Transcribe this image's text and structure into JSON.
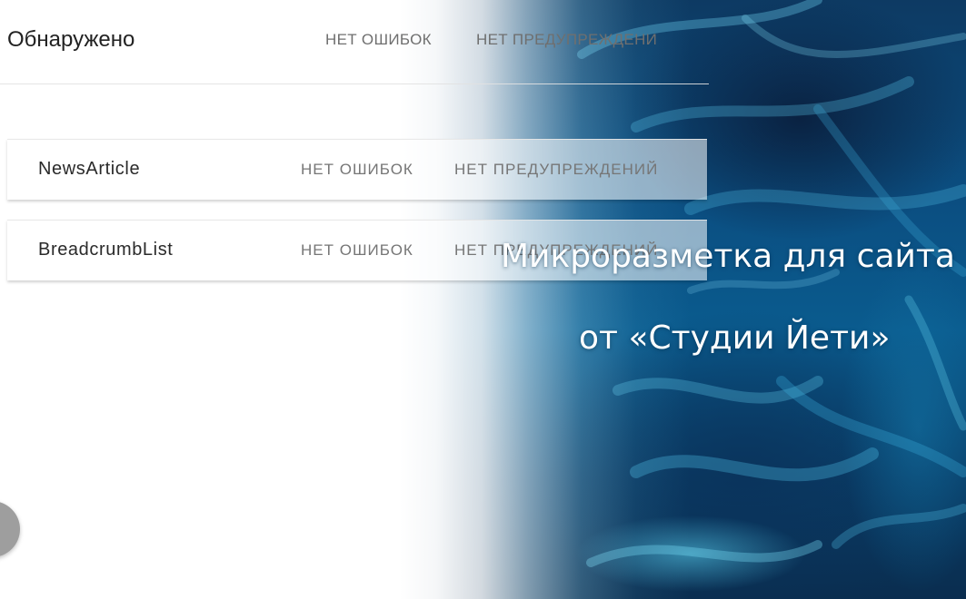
{
  "header": {
    "title": "Обнаружено",
    "errors_label": "НЕТ ОШИБОК",
    "warnings_label": "НЕТ ПРЕДУПРЕЖДЕНИ"
  },
  "items": [
    {
      "name": "NewsArticle",
      "errors": "НЕТ ОШИБОК",
      "warnings": "НЕТ ПРЕДУПРЕЖДЕНИЙ"
    },
    {
      "name": "BreadcrumbList",
      "errors": "НЕТ ОШИБОК",
      "warnings": "НЕТ ПРЕДУПРЕЖДЕНИЙ"
    }
  ],
  "promo": {
    "line1": "Микроразметка для сайта",
    "line2": "от «Студии Йети»"
  },
  "colors": {
    "text_dark": "#222222",
    "text_muted": "#767676",
    "bg_blue": "#0b4f82",
    "fab": "#9e9e9e"
  }
}
